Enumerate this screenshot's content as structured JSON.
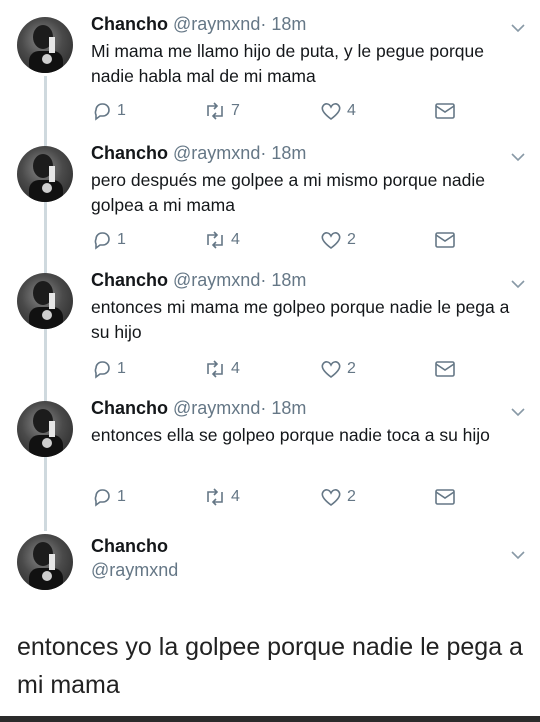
{
  "tweets": [
    {
      "name": "Chancho",
      "handle": "@raymxnd",
      "time": "· 18m",
      "text": "Mi mama me llamo hijo de puta, y le pegue porque nadie habla mal de mi mama",
      "replies": "1",
      "retweets": "7",
      "likes": "4"
    },
    {
      "name": "Chancho",
      "handle": "@raymxnd",
      "time": "· 18m",
      "text": "pero después me golpee a mi mismo porque nadie golpea a mi mama",
      "replies": "1",
      "retweets": "4",
      "likes": "2"
    },
    {
      "name": "Chancho",
      "handle": "@raymxnd",
      "time": "· 18m",
      "text": "entonces mi mama me golpeo porque nadie le pega a su hijo",
      "replies": "1",
      "retweets": "4",
      "likes": "2"
    },
    {
      "name": "Chancho",
      "handle": "@raymxnd",
      "time": "· 18m",
      "text": "entonces ella se golpeo porque nadie toca a su hijo",
      "replies": "1",
      "retweets": "4",
      "likes": "2"
    }
  ],
  "compose": {
    "name": "Chancho",
    "handle": "@raymxnd"
  },
  "caption": "entonces yo la golpee porque nadie le pega a mi mama",
  "icons": {
    "reply": "reply-icon",
    "retweet": "retweet-icon",
    "like": "heart-icon",
    "dm": "envelope-icon",
    "more": "chevron-down-icon"
  },
  "colors": {
    "text": "#14171a",
    "secondary": "#657786",
    "thread_line": "#cfd9de"
  }
}
